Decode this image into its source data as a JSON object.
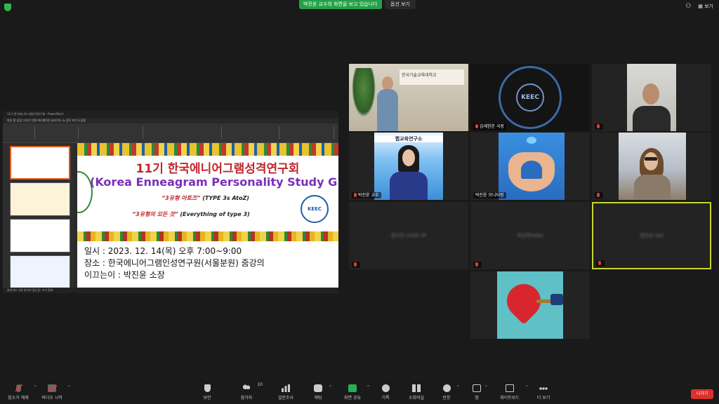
{
  "top": {
    "share_banner": "박진윤 교수의 화면을 보고 있습니다",
    "view_options": "옵션 보기",
    "view_label": "보기"
  },
  "shared_screen": {
    "ppt_title": "11기 한국에니어그램성격연구회 - PowerPoint",
    "ppt_menu": "파일   홈   삽입   디자인   전환   애니메이션   슬라이드 쇼   검토   보기   도움말",
    "ppt_status": "슬라이드 1/6   한국어   접근성: 조사 필요",
    "slide": {
      "title_ko": "11기 한국에니어그램성격연구회",
      "title_en": "(Korea Enneagram Personality Study G",
      "sub1_red": "“3유형 아토즈”",
      "sub1_rest": " (TYPE 3s AtoZ)",
      "sub2_red": "“3유형의 모든 것”",
      "sub2_rest": " (Everything of type 3)",
      "keec": "KEEC",
      "line1": "일시 : 2023. 12. 14(목) 오후 7:00~9:00",
      "line2": "장소 : 한국에니어그램인성연구원(서울분원) 줌강의",
      "line3": "이끄는이 : 박진윤 소장"
    }
  },
  "participants": [
    {
      "name": "",
      "sign": "한국기술교육대학교"
    },
    {
      "name": "김세현본 국장",
      "emblem": "KEEC"
    },
    {
      "name": ""
    },
    {
      "name": "박진윤 교수",
      "banner": "랩교육연구소"
    },
    {
      "name": "박진윤 모니터링"
    },
    {
      "name": ""
    },
    {
      "name": "",
      "blur": "정수진 1009 SP"
    },
    {
      "name": "",
      "blur": "최선학(4ds)"
    },
    {
      "name": "",
      "blur": "양진선 Ool"
    },
    {
      "name": ""
    }
  ],
  "toolbar": {
    "mute": "음소거 해제",
    "video": "비디오 시작",
    "security": "보안",
    "participants": "참가자",
    "participants_count": "10",
    "polls": "설문조사",
    "chat": "채팅",
    "share": "화면 공유",
    "record": "기록",
    "rooms": "소회의실",
    "reactions": "반응",
    "apps": "앱",
    "whiteboard": "화이트보드",
    "more": "더 보기",
    "leave": "나가기"
  },
  "colors": {
    "share_green": "#24a148",
    "leave_red": "#d9312c",
    "active_border": "#c8d430"
  }
}
